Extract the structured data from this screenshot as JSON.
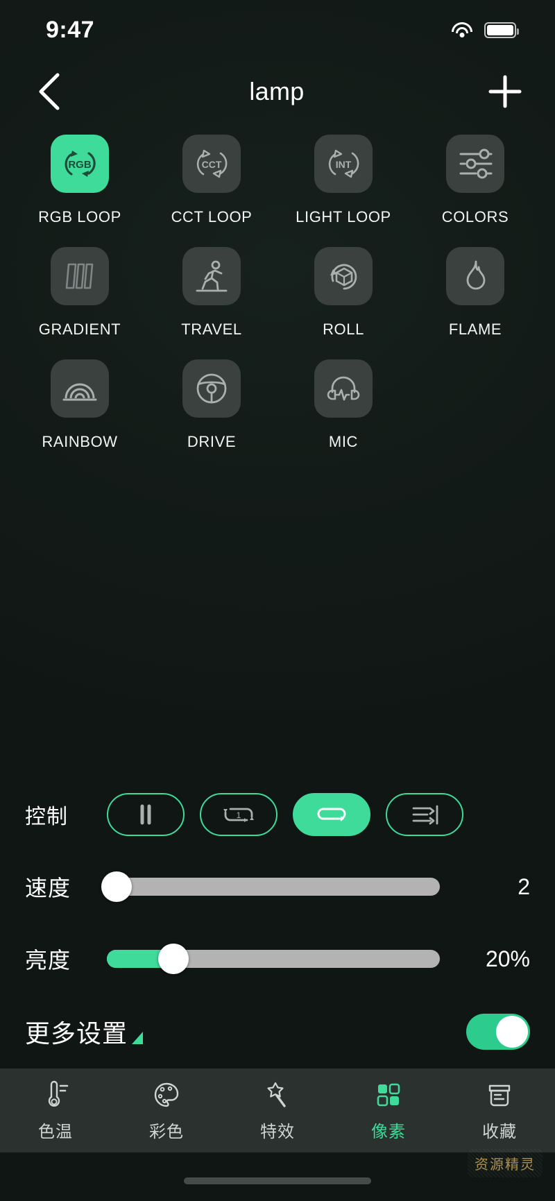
{
  "status": {
    "time": "9:47",
    "wifi_icon": "wifi-icon",
    "battery_icon": "battery-icon"
  },
  "nav": {
    "back_icon": "chevron-left-icon",
    "title": "lamp",
    "add_icon": "plus-icon"
  },
  "effects": [
    {
      "label": "RGB LOOP",
      "icon": "rgb-loop-icon",
      "selected": true
    },
    {
      "label": "CCT LOOP",
      "icon": "cct-loop-icon",
      "selected": false
    },
    {
      "label": "LIGHT LOOP",
      "icon": "int-loop-icon",
      "selected": false
    },
    {
      "label": "COLORS",
      "icon": "sliders-icon",
      "selected": false
    },
    {
      "label": "GRADIENT",
      "icon": "gradient-bars-icon",
      "selected": false
    },
    {
      "label": "TRAVEL",
      "icon": "running-person-icon",
      "selected": false
    },
    {
      "label": "ROLL",
      "icon": "rotating-cube-icon",
      "selected": false
    },
    {
      "label": "FLAME",
      "icon": "flame-icon",
      "selected": false
    },
    {
      "label": "RAINBOW",
      "icon": "rainbow-icon",
      "selected": false
    },
    {
      "label": "DRIVE",
      "icon": "steering-wheel-icon",
      "selected": false
    },
    {
      "label": "MIC",
      "icon": "headphone-wave-icon",
      "selected": false
    }
  ],
  "controls": {
    "label": "控制",
    "buttons": [
      {
        "icon": "pause-icon",
        "selected": false
      },
      {
        "icon": "repeat-one-icon",
        "selected": false
      },
      {
        "icon": "repeat-all-icon",
        "selected": true
      },
      {
        "icon": "play-to-end-icon",
        "selected": false
      }
    ]
  },
  "speed": {
    "label": "速度",
    "value": "2",
    "percent": 3
  },
  "bright": {
    "label": "亮度",
    "value": "20%",
    "percent": 20
  },
  "more": {
    "label": "更多设置",
    "caret_icon": "triangle-expand-icon",
    "toggle_on": true
  },
  "tabs": [
    {
      "label": "色温",
      "icon": "thermometer-icon",
      "active": false
    },
    {
      "label": "彩色",
      "icon": "palette-icon",
      "active": false
    },
    {
      "label": "特效",
      "icon": "magic-wand-icon",
      "active": false
    },
    {
      "label": "像素",
      "icon": "pixel-grid-icon",
      "active": true
    },
    {
      "label": "收藏",
      "icon": "archive-box-icon",
      "active": false
    }
  ],
  "watermark": "资源精灵",
  "colors": {
    "accent": "#3edb9a",
    "tile": "#3a413e",
    "background": "#101614",
    "tabbar": "#2b312f"
  }
}
